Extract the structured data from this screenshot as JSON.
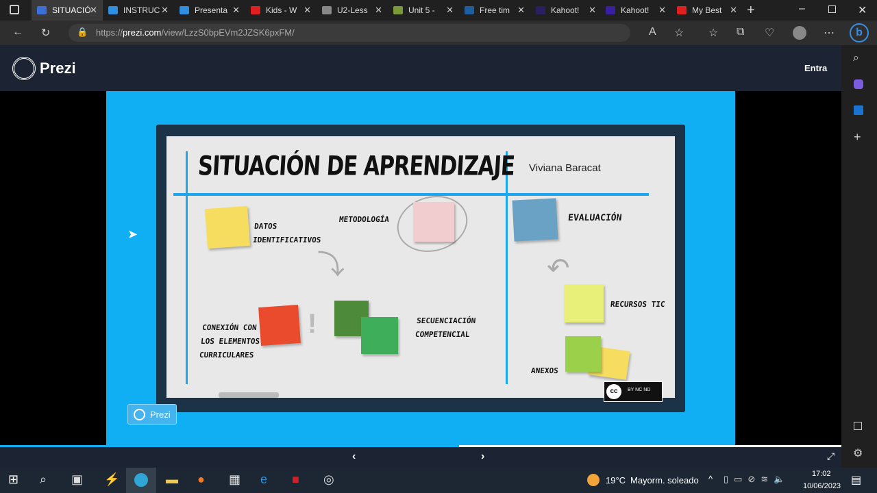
{
  "browser": {
    "tabs": [
      {
        "label": "SITUACIÓ",
        "color": "#3d6fd8",
        "active": true
      },
      {
        "label": "INSTRUC",
        "color": "#2f8ee0"
      },
      {
        "label": "Presenta",
        "color": "#2f8ee0"
      },
      {
        "label": "Kids - W",
        "color": "#e02020"
      },
      {
        "label": "U2-Less",
        "color": "#888888"
      },
      {
        "label": "Unit 5 -",
        "color": "#7a9a3a"
      },
      {
        "label": "Free tim",
        "color": "#1f5f9f"
      },
      {
        "label": "Kahoot!",
        "color": "#2a1f5f"
      },
      {
        "label": "Kahoot!",
        "color": "#3a1fa0"
      },
      {
        "label": "My Best",
        "color": "#e02020"
      }
    ],
    "url_prefix": "https://",
    "url_domain": "prezi.com",
    "url_path": "/view/LzzS0bpEVm2JZSK6pxFM/"
  },
  "prezi": {
    "logo": "Prezi",
    "login": "Entra",
    "badge": "Prezi"
  },
  "slide": {
    "title": "SITUACIÓN DE APRENDIZAJE",
    "author": "Viviana Baracat",
    "items": {
      "datos": "DATOS IDENTIFICATIVOS",
      "metodologia": "METODOLOGÍA",
      "evaluacion": "EVALUACIÓN",
      "conexion": "CONEXIÓN CON LOS ELEMENTOS CURRICULARES",
      "secuenciacion": "SECUENCIACIÓN COMPETENCIAL",
      "recursos": "RECURSOS TIC",
      "anexos": "ANEXOS"
    },
    "license": "BY NC ND"
  },
  "taskbar": {
    "temp": "19°C",
    "weather": "Mayorm. soleado",
    "time": "17:02",
    "date": "10/06/2023"
  }
}
